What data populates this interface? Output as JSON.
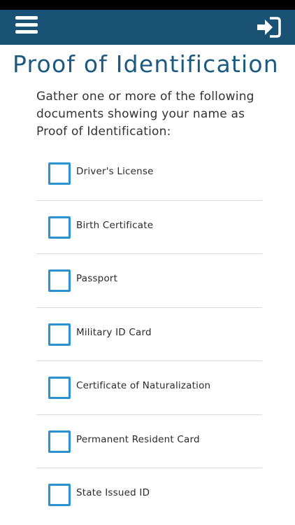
{
  "header": {
    "menu_icon": "hamburger-menu-icon",
    "login_icon": "sign-in-icon",
    "background_color": "#1a5276"
  },
  "page": {
    "title": "Proof of Identification",
    "intro": "Gather one or more of the following documents showing your name as Proof of Identification:"
  },
  "documents": [
    {
      "label": "Driver's License",
      "checked": false
    },
    {
      "label": "Birth Certificate",
      "checked": false
    },
    {
      "label": "Passport",
      "checked": false
    },
    {
      "label": "Military ID Card",
      "checked": false
    },
    {
      "label": "Certificate of Naturalization",
      "checked": false
    },
    {
      "label": "Permanent Resident Card",
      "checked": false
    },
    {
      "label": "State Issued ID",
      "checked": false
    }
  ],
  "colors": {
    "title": "#1b5a80",
    "checkbox_border": "#2b91cf"
  }
}
